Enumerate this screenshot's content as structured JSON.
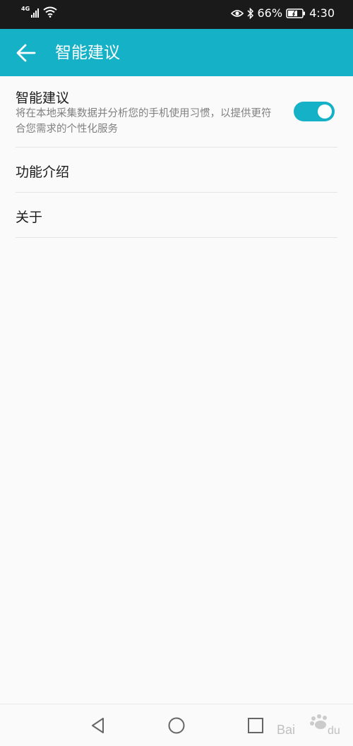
{
  "status_bar": {
    "network": "4G",
    "battery_percent": "66%",
    "time": "4:30",
    "icons": [
      "signal-icon",
      "wifi-icon",
      "eye-icon",
      "bluetooth-icon",
      "battery-icon"
    ]
  },
  "app_bar": {
    "title": "智能建议",
    "back_icon": "back-arrow-icon"
  },
  "settings": {
    "main": {
      "title": "智能建议",
      "description": "将在本地采集数据并分析您的手机使用习惯，以提供更符合您需求的个性化服务",
      "toggle_on": true
    },
    "items": [
      {
        "label": "功能介绍"
      },
      {
        "label": "关于"
      }
    ]
  },
  "nav_bar": {
    "buttons": [
      "back-triangle-icon",
      "home-circle-icon",
      "recents-square-icon"
    ]
  },
  "colors": {
    "accent": "#14b1c7",
    "status_bar_bg": "#1a1a1a",
    "background": "#fafafa",
    "divider": "#e4e4e4",
    "secondary_text": "#808080"
  }
}
